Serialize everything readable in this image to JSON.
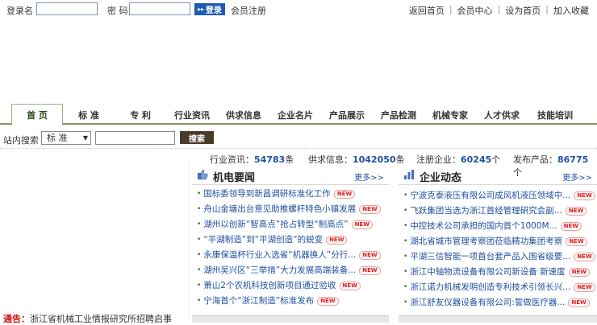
{
  "topbar": {
    "username_label": "登录名",
    "password_label": "密 码",
    "login_button": "登录",
    "register_link": "会员注册",
    "links": [
      "返回首页",
      "会员中心",
      "设为首页",
      "加入收藏"
    ]
  },
  "nav": {
    "tabs": [
      "首 页",
      "标 准",
      "专 利",
      "行业资讯",
      "供求信息",
      "企业名片",
      "产品展示",
      "产品检测",
      "机械专家",
      "人才供求",
      "技能培训"
    ],
    "active_index": 0
  },
  "search": {
    "label": "站内搜索",
    "select_value": "标 准",
    "button": "搜索"
  },
  "stats": [
    {
      "label": "行业资讯：",
      "value": "54783",
      "unit": "条"
    },
    {
      "label": "供求信息：",
      "value": "1042050",
      "unit": "条"
    },
    {
      "label": "注册企业：",
      "value": "60245",
      "unit": "个"
    },
    {
      "label": "发布产品：",
      "value": "86775",
      "unit": "个"
    }
  ],
  "panel_news": {
    "title": "机电要闻",
    "more": "更多>>",
    "items": [
      "国标委领导到新昌调研标准化工作",
      "舟山金塘出台意见助推螺杆特色小镇发展",
      "湖州以创新“智高点”抢占转型“制高点”",
      "“平湖制造”到“平湖创造”的蜕变",
      "永康保温杯行业入选省“机器换人”分行...",
      "湖州吴兴区“三举措”大力发展高端装备...",
      "萧山2个农机科技创新项目通过验收",
      "宁海首个“浙江制造”标准发布"
    ],
    "badge": "NEW"
  },
  "panel_company": {
    "title": "企业动态",
    "more": "更多>>",
    "items": [
      "宁波克泰液压有限公司成风机液压领域中...",
      "飞跃集团当选为浙江首经管理研究会副...",
      "中控技术公司承担的国内首个1000M...",
      "湖北省城市管理考察团莅临精功集团考察",
      "平湖三信智能一项首台套产品入围省级要...",
      "浙江中轴物流设备有限公司新设备 新速度",
      "浙江诺力机械发明创造专利技术引领长兴...",
      "浙江舒友仪器设备有限公司:誓做医疗器..."
    ],
    "badge": "NEW"
  },
  "bottom_left": {
    "tag": "通告：",
    "text": "浙江省机械工业情报研究所招聘启事"
  }
}
